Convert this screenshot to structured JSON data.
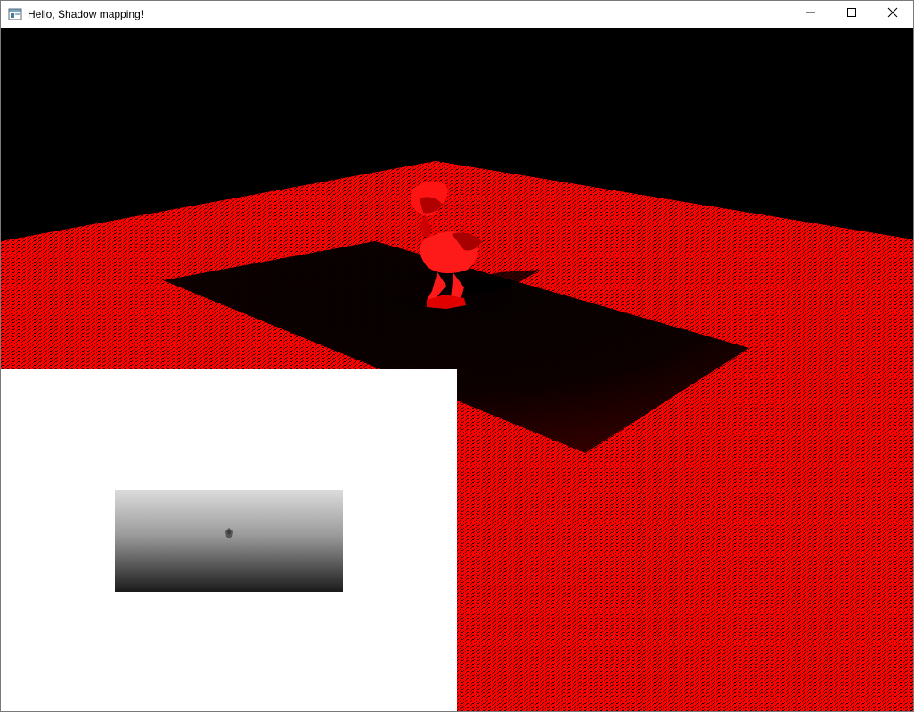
{
  "window": {
    "title": "Hello, Shadow mapping!",
    "icons": {
      "app": "app-window-icon",
      "minimize": "minimize-icon",
      "maximize": "maximize-icon",
      "close": "close-icon"
    }
  },
  "scene": {
    "background_color": "#000000",
    "floor_color": "#ff0000",
    "shadow_color": "#000000",
    "model_color": "#ff1a1a"
  },
  "debug_view": {
    "panel_color": "#ffffff",
    "depth_gradient_top": "#dcdcdc",
    "depth_gradient_bottom": "#1a1a1a"
  }
}
